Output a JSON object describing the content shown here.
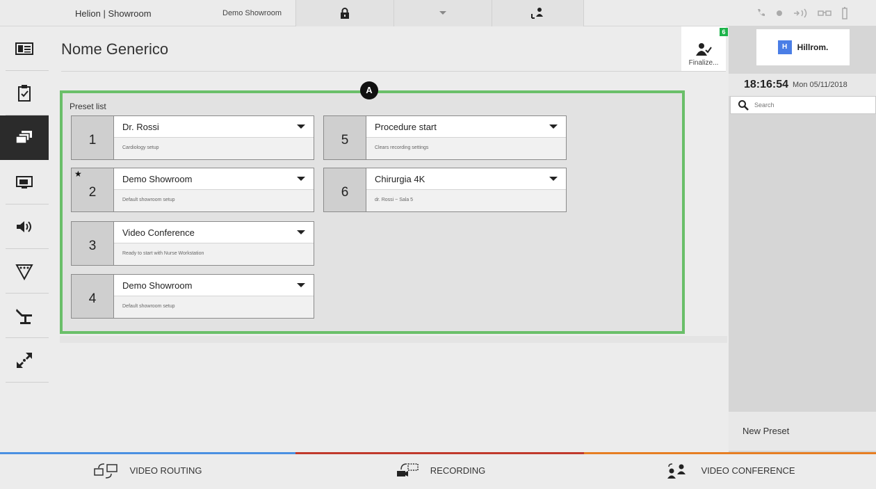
{
  "topbar": {
    "app_title": "Helion | Showroom",
    "room": "Demo Showroom"
  },
  "page": {
    "title": "Nome Generico",
    "finalize_label": "Finalize...",
    "finalize_badge": "6",
    "marker": "A"
  },
  "preset_list": {
    "label": "Preset list",
    "items": [
      {
        "number": "1",
        "name": "Dr. Rossi",
        "description": "Cardiology setup",
        "starred": false
      },
      {
        "number": "2",
        "name": "Demo Showroom",
        "description": "Default showroom setup",
        "starred": true
      },
      {
        "number": "3",
        "name": "Video Conference",
        "description": "Ready to start with Nurse Workstation",
        "starred": false
      },
      {
        "number": "4",
        "name": "Demo Showroom",
        "description": "Default showroom setup",
        "starred": false
      },
      {
        "number": "5",
        "name": "Procedure start",
        "description": "Clears recording settings",
        "starred": false
      },
      {
        "number": "6",
        "name": "Chirurgia 4K",
        "description": "dr. Rossi ~ Sala 5",
        "starred": false
      }
    ],
    "star_glyph": "★"
  },
  "right_panel": {
    "brand": "Hillrom.",
    "brand_mark": "H",
    "time": "18:16:54",
    "date": "Mon 05/11/2018",
    "search_placeholder": "Search",
    "new_preset": "New Preset"
  },
  "bottom_tabs": [
    {
      "label": "VIDEO ROUTING",
      "accent": "#4a90e2"
    },
    {
      "label": "RECORDING",
      "accent": "#c0392b"
    },
    {
      "label": "VIDEO CONFERENCE",
      "accent": "#e67e22"
    }
  ],
  "colors": {
    "highlight": "#6abf69",
    "active_nav": "#2b2b2b",
    "badge": "#1db34a"
  }
}
